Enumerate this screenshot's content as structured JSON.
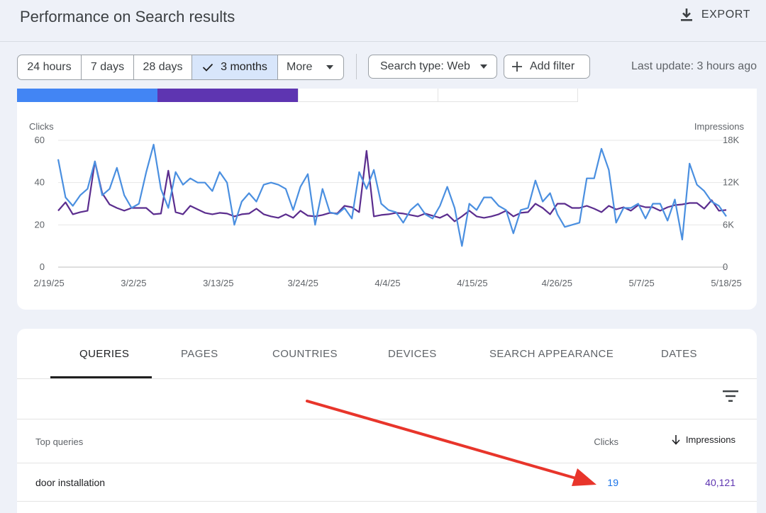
{
  "header": {
    "title": "Performance on Search results",
    "export_label": "EXPORT"
  },
  "date_range": {
    "options": [
      "24 hours",
      "7 days",
      "28 days",
      "3 months",
      "More"
    ],
    "selected": "3 months"
  },
  "filters": {
    "search_type": "Search type: Web",
    "add_filter": "Add filter",
    "last_update": "Last update: 3 hours ago"
  },
  "colors": {
    "clicks": "#4a8fe0",
    "impressions": "#5b2d8e",
    "annotation_arrow": "#e8352b"
  },
  "chart_data": {
    "type": "line",
    "left_axis_label": "Clicks",
    "right_axis_label": "Impressions",
    "left_ticks": [
      "0",
      "20",
      "40",
      "60"
    ],
    "right_ticks": [
      "0",
      "6K",
      "12K",
      "18K"
    ],
    "left_ylim": [
      0,
      60
    ],
    "right_ylim": [
      0,
      18000
    ],
    "x_tick_labels": [
      "2/19/25",
      "3/2/25",
      "3/13/25",
      "3/24/25",
      "4/4/25",
      "4/15/25",
      "4/26/25",
      "5/7/25",
      "5/18/25"
    ],
    "grid": true,
    "series": [
      {
        "name": "Clicks",
        "axis": "left",
        "values": [
          51,
          33,
          29,
          34,
          37,
          50,
          34,
          37,
          47,
          34,
          28,
          30,
          45,
          58,
          37,
          28,
          45,
          39,
          42,
          40,
          40,
          36,
          45,
          40,
          20,
          31,
          35,
          31,
          39,
          40,
          39,
          37,
          27,
          38,
          44,
          20,
          37,
          26,
          25,
          28,
          23,
          45,
          37,
          46,
          30,
          27,
          26,
          21,
          27,
          30,
          25,
          23,
          29,
          38,
          28,
          10,
          30,
          27,
          33,
          33,
          29,
          27,
          16,
          27,
          28,
          41,
          31,
          35,
          25,
          19,
          20,
          21,
          42,
          42,
          56,
          46,
          21,
          28,
          28,
          30,
          23,
          30,
          30,
          22,
          32,
          13,
          49,
          39,
          36,
          31,
          29,
          24
        ]
      },
      {
        "name": "Impressions",
        "axis": "right",
        "values": [
          8000,
          9200,
          7500,
          7800,
          8000,
          15000,
          10500,
          8900,
          8400,
          8000,
          8400,
          8400,
          8400,
          7500,
          7600,
          13700,
          7800,
          7500,
          8700,
          8200,
          7700,
          7500,
          7700,
          7600,
          7200,
          7500,
          7600,
          8300,
          7500,
          7200,
          7000,
          7500,
          7000,
          8000,
          7300,
          7200,
          7400,
          7700,
          7600,
          8700,
          8500,
          7800,
          16500,
          7200,
          7400,
          7500,
          7700,
          7600,
          7400,
          7200,
          7600,
          7300,
          7000,
          7500,
          6500,
          7200,
          8000,
          7200,
          7000,
          7200,
          7500,
          8000,
          7200,
          7700,
          7800,
          9000,
          8400,
          7500,
          9000,
          9000,
          8400,
          8400,
          8700,
          8300,
          7800,
          8700,
          8200,
          8500,
          8000,
          8800,
          8500,
          8500,
          8000,
          8500,
          8800,
          8900,
          9100,
          9100,
          8300,
          9500,
          8000,
          8100
        ]
      }
    ]
  },
  "tabs": [
    "QUERIES",
    "PAGES",
    "COUNTRIES",
    "DEVICES",
    "SEARCH APPEARANCE",
    "DATES"
  ],
  "table": {
    "headers": {
      "query": "Top queries",
      "clicks": "Clicks",
      "impressions": "Impressions"
    },
    "rows": [
      {
        "query": "door installation",
        "clicks": "19",
        "impressions": "40,121"
      }
    ]
  }
}
